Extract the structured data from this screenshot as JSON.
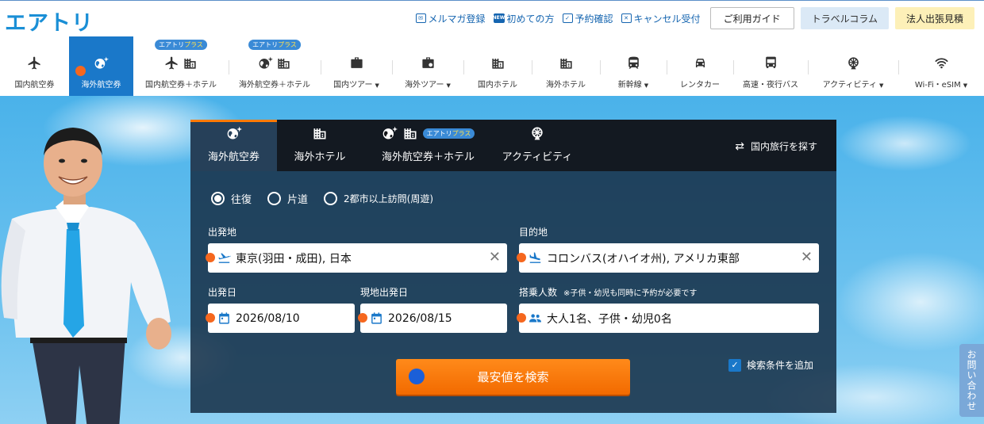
{
  "brand": {
    "logo": "エアトリ",
    "accent": "#1a78c9",
    "orange": "#f26a00"
  },
  "toplinks": [
    {
      "label": "メルマガ登録",
      "icon": "mail-icon"
    },
    {
      "label": "初めての方",
      "icon": "new-icon"
    },
    {
      "label": "予約確認",
      "icon": "calendar-check-icon"
    },
    {
      "label": "キャンセル受付",
      "icon": "cancel-icon"
    }
  ],
  "topbuttons": {
    "guide": "ご利用ガイド",
    "column": "トラベルコラム",
    "corp": "法人出張見積"
  },
  "nav": {
    "plus_badge_a": "エアトリ",
    "plus_badge_b": "プラス",
    "items": [
      {
        "label": "国内航空券"
      },
      {
        "label": "海外航空券"
      },
      {
        "label": "国内航空券＋ホテル"
      },
      {
        "label": "海外航空券＋ホテル"
      },
      {
        "label": "国内ツアー"
      },
      {
        "label": "海外ツアー"
      },
      {
        "label": "国内ホテル"
      },
      {
        "label": "海外ホテル"
      },
      {
        "label": "新幹線"
      },
      {
        "label": "レンタカー"
      },
      {
        "label": "高速・夜行バス"
      },
      {
        "label": "アクティビティ"
      },
      {
        "label": "Wi-Fi・eSIM"
      }
    ]
  },
  "search": {
    "tabs": [
      {
        "label": "海外航空券"
      },
      {
        "label": "海外ホテル"
      },
      {
        "label": "海外航空券＋ホテル"
      },
      {
        "label": "アクティビティ"
      }
    ],
    "domestic_link": "国内旅行を探す",
    "trip_types": [
      "往復",
      "片道",
      "2都市以上訪問(周遊)"
    ],
    "selected_trip": "往復",
    "labels": {
      "origin": "出発地",
      "destination": "目的地",
      "depart_date": "出発日",
      "return_date": "現地出発日",
      "passengers": "搭乗人数",
      "passengers_note": "※子供・幼児も同時に予約が必要です"
    },
    "values": {
      "origin": "東京(羽田・成田), 日本",
      "destination": "コロンバス(オハイオ州), アメリカ東部",
      "depart_date": "2026/08/10",
      "return_date": "2026/08/15",
      "passengers": "大人1名、子供・幼児0名"
    },
    "submit": "最安値を検索",
    "add_conditions": "検索条件を追加",
    "add_conditions_checked": true
  },
  "contact_tab": "お問い合わせ"
}
